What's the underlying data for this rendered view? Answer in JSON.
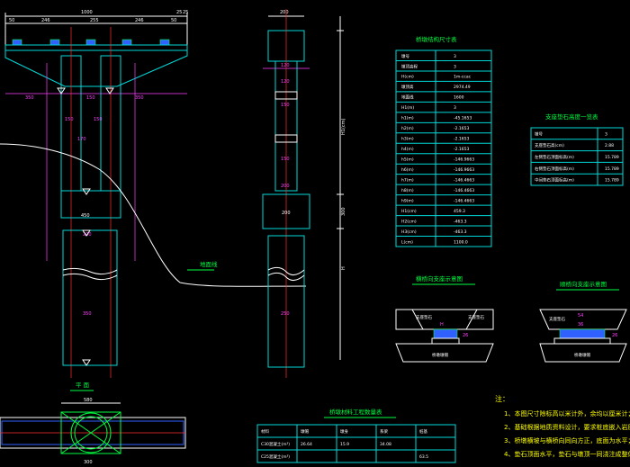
{
  "titles": {
    "table_main": "桥墩结构尺寸表",
    "table_support": "支座垫石高度一览表",
    "section_a": "横桥向支座示意图",
    "section_b": "顺桥向支座示意图",
    "plan": "平 面",
    "quantities": "桥墩材料工程数量表",
    "ground_line": "地面线",
    "notes_head": "注："
  },
  "notes": [
    "1、本图尺寸除标高以米计外，余均以厘米计；",
    "2、基础根据地质资料设计，要求桩底嵌入岩层深度不",
    "3、桥墩横坡与横桥向同向方正，底面为水平；施测",
    "4、垫石顶面水平，垫石与墩顶一同浇注成整体；"
  ],
  "dims_elev": {
    "top": [
      "1000",
      "50",
      "246",
      "255",
      "246",
      "50",
      "25",
      "25"
    ],
    "cap_sides": [
      "350",
      "350",
      "150"
    ],
    "mid": [
      "150",
      "150",
      "170"
    ],
    "bottom": [
      "450",
      "350",
      "200"
    ]
  },
  "dims_side": {
    "top": "200",
    "cap": "120",
    "inner": [
      "120",
      "150",
      "150",
      "200"
    ],
    "mid": "200",
    "pile": "250",
    "vertical": [
      "H1(cm)",
      "300",
      "H"
    ]
  },
  "main_table": {
    "header": [
      "墩号",
      "3"
    ],
    "rows": [
      [
        "墩顶高程",
        "3"
      ],
      [
        "H(cm)",
        "1m-ccac"
      ],
      [
        "墩顶高",
        "2974.49"
      ],
      [
        "地面线",
        "1600"
      ],
      [
        "H1(m)",
        "3"
      ],
      [
        "h1(m)",
        "-45.1653"
      ],
      [
        "h2(m)",
        "-2.1653"
      ],
      [
        "h3(m)",
        "-2.1653"
      ],
      [
        "h4(m)",
        "-2.1653"
      ],
      [
        "h5(m)",
        "-146.9663"
      ],
      [
        "h6(m)",
        "-146.9663"
      ],
      [
        "h7(m)",
        "-146.4663"
      ],
      [
        "h8(m)",
        "-146.4663"
      ],
      [
        "h9(m)",
        "-146.4663"
      ],
      [
        "H1(cm)",
        "459.3"
      ],
      [
        "H2(cm)",
        "-463.3"
      ],
      [
        "H3(cm)",
        "-463.3"
      ],
      [
        "L(cm)",
        "1100.0"
      ]
    ]
  },
  "support_table": {
    "header": [
      "墩号",
      "3"
    ],
    "rows": [
      [
        "支座垫石高(cm)",
        "2.88"
      ],
      [
        "左侧垫石顶面标高(m)",
        "15.789"
      ],
      [
        "右侧垫石顶面标高(m)",
        "15.789"
      ],
      [
        "中间垫石顶面标高(m)",
        "15.789"
      ]
    ]
  },
  "qty_table": {
    "header": [
      "材料",
      "墩帽",
      "墩身",
      "系梁",
      "桩基"
    ],
    "rows": [
      [
        "C30混凝土(m³)",
        "26.64",
        "15.9",
        "34.08",
        ""
      ],
      [
        "C25混凝土(m³)",
        "",
        "",
        "",
        "63.5"
      ]
    ]
  },
  "bearing_labels": {
    "a_left": "支座垫石",
    "a_right": "支座垫石",
    "a_base": "桥墩墩帽",
    "a_dims": [
      "H",
      "26"
    ],
    "b_left": "支座垫石",
    "b_base": "桥墩墩帽",
    "b_dims": [
      "54",
      "36",
      "26"
    ]
  },
  "plan_dims": [
    "580",
    "300"
  ]
}
